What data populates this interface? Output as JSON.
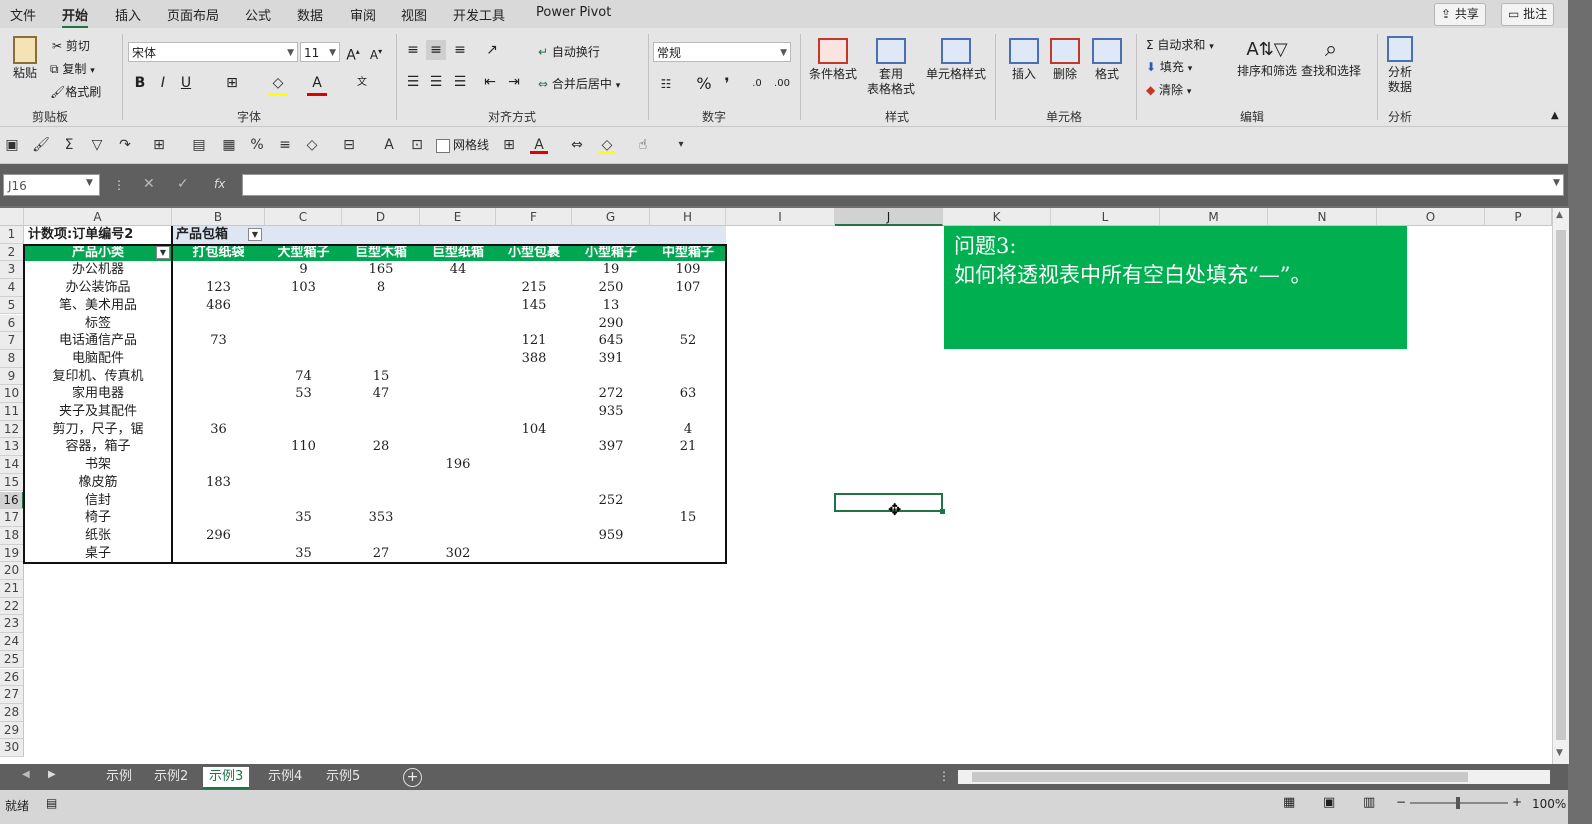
{
  "menu": {
    "tabs": [
      "文件",
      "开始",
      "插入",
      "页面布局",
      "公式",
      "数据",
      "审阅",
      "视图",
      "开发工具",
      "Power Pivot"
    ],
    "active_tab": "开始",
    "share": "共享",
    "comments": "批注"
  },
  "ribbon": {
    "clipboard": {
      "paste": "粘贴",
      "cut": "剪切",
      "copy": "复制",
      "format_painter": "格式刷",
      "label": "剪贴板"
    },
    "font": {
      "name": "宋体",
      "size": "11",
      "bold": "B",
      "italic": "I",
      "underline": "U",
      "label": "字体"
    },
    "alignment": {
      "wrap": "自动换行",
      "merge": "合并后居中",
      "label": "对齐方式"
    },
    "number": {
      "format": "常规",
      "percent": "%",
      "label": "数字"
    },
    "styles": {
      "conditional": "条件格式",
      "table_fmt_1": "套用",
      "table_fmt_2": "表格格式",
      "cell_styles": "单元格样式",
      "label": "样式"
    },
    "cells": {
      "insert": "插入",
      "delete": "删除",
      "format": "格式",
      "label": "单元格"
    },
    "editing": {
      "autosum": "自动求和",
      "fill": "填充",
      "clear": "清除",
      "sort_filter": "排序和筛选",
      "find_select": "查找和选择",
      "label": "编辑"
    },
    "analysis": {
      "analyze_1": "分析",
      "analyze_2": "数据",
      "label": "分析"
    }
  },
  "qat": {
    "gridlines": "网格线"
  },
  "formula_bar": {
    "name_box": "J16",
    "fx": "fx",
    "content": ""
  },
  "grid": {
    "columns": [
      "A",
      "B",
      "C",
      "D",
      "E",
      "F",
      "G",
      "H",
      "I",
      "J",
      "K",
      "L",
      "M",
      "N",
      "O",
      "P"
    ],
    "selected_column": "J",
    "rows": [
      "1",
      "2",
      "3",
      "4",
      "5",
      "6",
      "7",
      "8",
      "9",
      "10",
      "11",
      "12",
      "13",
      "14",
      "15",
      "16",
      "17",
      "18",
      "19",
      "20",
      "21",
      "22",
      "23",
      "24",
      "25",
      "26",
      "27",
      "28",
      "29",
      "30"
    ],
    "selected_row": "16",
    "active_cell": "J16"
  },
  "pivot": {
    "count_label": "计数项:订单编号2",
    "col_field": "产品包箱",
    "row_field": "产品小类",
    "headers": [
      "打包纸袋",
      "大型箱子",
      "巨型木箱",
      "巨型纸箱",
      "小型包裹",
      "小型箱子",
      "中型箱子"
    ],
    "rows": [
      {
        "label": "办公机器",
        "values": [
          "",
          "9",
          "165",
          "44",
          "",
          "19",
          "109"
        ]
      },
      {
        "label": "办公装饰品",
        "values": [
          "123",
          "103",
          "8",
          "",
          "215",
          "250",
          "107"
        ]
      },
      {
        "label": "笔、美术用品",
        "values": [
          "486",
          "",
          "",
          "",
          "145",
          "13",
          ""
        ]
      },
      {
        "label": "标签",
        "values": [
          "",
          "",
          "",
          "",
          "",
          "290",
          ""
        ]
      },
      {
        "label": "电话通信产品",
        "values": [
          "73",
          "",
          "",
          "",
          "121",
          "645",
          "52"
        ]
      },
      {
        "label": "电脑配件",
        "values": [
          "",
          "",
          "",
          "",
          "388",
          "391",
          ""
        ]
      },
      {
        "label": "复印机、传真机",
        "values": [
          "",
          "74",
          "15",
          "",
          "",
          "",
          ""
        ]
      },
      {
        "label": "家用电器",
        "values": [
          "",
          "53",
          "47",
          "",
          "",
          "272",
          "63"
        ]
      },
      {
        "label": "夹子及其配件",
        "values": [
          "",
          "",
          "",
          "",
          "",
          "935",
          ""
        ]
      },
      {
        "label": "剪刀，尺子，锯",
        "values": [
          "36",
          "",
          "",
          "",
          "104",
          "",
          "4"
        ]
      },
      {
        "label": "容器，箱子",
        "values": [
          "",
          "110",
          "28",
          "",
          "",
          "397",
          "21"
        ]
      },
      {
        "label": "书架",
        "values": [
          "",
          "",
          "",
          "196",
          "",
          "",
          ""
        ]
      },
      {
        "label": "橡皮筋",
        "values": [
          "183",
          "",
          "",
          "",
          "",
          "",
          ""
        ]
      },
      {
        "label": "信封",
        "values": [
          "",
          "",
          "",
          "",
          "",
          "252",
          ""
        ]
      },
      {
        "label": "椅子",
        "values": [
          "",
          "35",
          "353",
          "",
          "",
          "",
          "15"
        ]
      },
      {
        "label": "纸张",
        "values": [
          "296",
          "",
          "",
          "",
          "",
          "959",
          ""
        ]
      },
      {
        "label": "桌子",
        "values": [
          "",
          "35",
          "27",
          "302",
          "",
          "",
          ""
        ]
      }
    ]
  },
  "note": {
    "line1": "问题3:",
    "line2": "如何将透视表中所有空白处填充“—”。"
  },
  "sheets": {
    "tabs": [
      "示例",
      "示例2",
      "示例3",
      "示例4",
      "示例5"
    ],
    "active": "示例3"
  },
  "status": {
    "ready": "就绪",
    "zoom": "100%"
  },
  "colors": {
    "accent_green": "#217346",
    "pivot_header_green": "#00a651",
    "note_green": "#00b050"
  }
}
